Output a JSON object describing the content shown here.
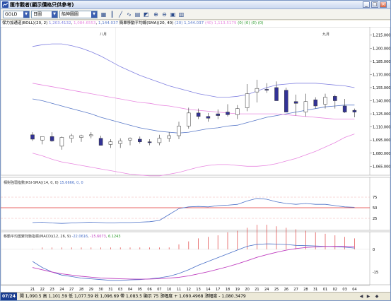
{
  "window": {
    "title": "匯市觀者(顯示價格只供參考)",
    "buttons": [
      "_",
      "□",
      "×"
    ]
  },
  "toolbar": {
    "symbol": "GOLD",
    "period": "日圖",
    "chart_style": "船神圖圖",
    "icon_names": [
      "bar-chart-icon",
      "candlestick-icon",
      "line-chart-icon",
      "indicator-icon",
      "area-chart-icon",
      "chart-type-icon",
      "zoom-in-icon",
      "zoom-out-icon",
      "window-icon",
      "print-icon"
    ]
  },
  "legend": {
    "label": "保力加通道(BOLL)(20, 2)",
    "upper": "1,203.4132",
    "lower": "1,084.6553",
    "mid": "1,144.037",
    "sma_label": "簡單移動平均線(SMA)(20, 40)",
    "sma20_text": "(20)",
    "sma20": "1,144.037",
    "sma40_text": "(40)",
    "sma40": "1,113.5179",
    "tail": "(0) (0) (0) (0)"
  },
  "months": [
    "八月",
    "九月"
  ],
  "price_axis": [
    "1,215.0000",
    "1,200.0000",
    "1,185.0000",
    "1,170.0000",
    "1,155.0000",
    "1,140.0000",
    "1,125.0000",
    "1,110.0000",
    "1,095.0000",
    "1,080.0000",
    "1,065.0000"
  ],
  "rsi": {
    "title_a": "相對強弱指數(RSI-SMA)(14, 0, 0)",
    "value": "15.6666, 0, 0",
    "axis": [
      "75",
      "50",
      "25"
    ]
  },
  "macd": {
    "title_a": "移動平均匯聚背馳指標(MACD)(12, 26, 9)",
    "v1": "-22.0616",
    "v2": "-15.6073",
    "v3": "6.1243",
    "axis": [
      "0",
      "-15"
    ]
  },
  "dates": [
    "21",
    "22",
    "23",
    "24",
    "27",
    "28",
    "29",
    "30",
    "31",
    "03",
    "04",
    "05",
    "06",
    "07",
    "10",
    "11",
    "12",
    "13",
    "14",
    "17",
    "18",
    "19",
    "20",
    "21",
    "24",
    "25",
    "26",
    "27",
    "28",
    "31",
    "01",
    "02",
    "03",
    "04"
  ],
  "status": {
    "date": "07/24",
    "text": "開 1,090.5  高 1,101.59  低 1,077.59  收 1,096.69  帶 1,083.5  顯示 75  漲幅度 + 1,090.4968  漲幅度 - 1,080.3479"
  },
  "colors": {
    "boll": "#8080e0",
    "sma20": "#5878c8",
    "sma40": "#e888e0",
    "candle": "#323296",
    "rsi": "#4a70c8",
    "rsi_ref": "#e03030",
    "macd_bar": "#e04040",
    "macd_line": "#4a70c8",
    "macd_signal": "#c040c0"
  },
  "chart_data": {
    "type": "candlestick",
    "x": [
      "21",
      "22",
      "23",
      "24",
      "27",
      "28",
      "29",
      "30",
      "31",
      "03",
      "04",
      "05",
      "06",
      "07",
      "10",
      "11",
      "12",
      "13",
      "14",
      "17",
      "18",
      "19",
      "20",
      "21",
      "24",
      "25",
      "26",
      "27",
      "28",
      "31",
      "01",
      "02",
      "03",
      "04"
    ],
    "open": [
      1101,
      1095,
      1099,
      1088,
      1097,
      1098,
      1100,
      1097,
      1090,
      1091,
      1095,
      1096,
      1093,
      1092,
      1097,
      1100,
      1111,
      1126,
      1122,
      1125,
      1127,
      1124,
      1132,
      1150,
      1153,
      1155,
      1152,
      1139,
      1127,
      1141,
      1136,
      1145,
      1134,
      1129
    ],
    "high": [
      1104,
      1099,
      1104,
      1099,
      1102,
      1101,
      1104,
      1100,
      1096,
      1097,
      1098,
      1099,
      1096,
      1101,
      1104,
      1116,
      1132,
      1131,
      1126,
      1130,
      1136,
      1135,
      1159,
      1164,
      1160,
      1162,
      1155,
      1147,
      1148,
      1144,
      1148,
      1147,
      1142,
      1131
    ],
    "low": [
      1094,
      1090,
      1093,
      1084,
      1092,
      1093,
      1097,
      1089,
      1086,
      1086,
      1089,
      1091,
      1089,
      1089,
      1093,
      1096,
      1108,
      1119,
      1116,
      1119,
      1122,
      1119,
      1128,
      1138,
      1149,
      1141,
      1128,
      1123,
      1122,
      1131,
      1131,
      1131,
      1126,
      1121
    ],
    "close": [
      1096,
      1099,
      1094,
      1098,
      1100,
      1100,
      1101,
      1089,
      1093,
      1094,
      1097,
      1093,
      1092,
      1097,
      1100,
      1111,
      1126,
      1122,
      1120,
      1123,
      1124,
      1131,
      1148,
      1154,
      1152,
      1140,
      1127,
      1137,
      1139,
      1134,
      1144,
      1140,
      1127,
      1127
    ],
    "boll_upper": [
      1202,
      1204,
      1205,
      1205,
      1203,
      1200,
      1196,
      1191,
      1185,
      1179,
      1174,
      1169,
      1165,
      1161,
      1157,
      1154,
      1151,
      1148,
      1146,
      1144,
      1144,
      1145,
      1147,
      1151,
      1155,
      1158,
      1159,
      1160,
      1160,
      1160,
      1159,
      1158,
      1157,
      1155
    ],
    "boll_mid": [
      1142,
      1140,
      1137,
      1134,
      1131,
      1128,
      1125,
      1121,
      1118,
      1115,
      1112,
      1109,
      1107,
      1105,
      1104,
      1103,
      1104,
      1106,
      1108,
      1109,
      1111,
      1112,
      1115,
      1118,
      1121,
      1123,
      1125,
      1127,
      1129,
      1131,
      1133,
      1134,
      1135,
      1135
    ],
    "boll_lower": [
      1080,
      1077,
      1073,
      1070,
      1068,
      1066,
      1064,
      1062,
      1060,
      1058,
      1056,
      1055,
      1054,
      1054,
      1056,
      1058,
      1061,
      1064,
      1066,
      1067,
      1067,
      1066,
      1065,
      1065,
      1066,
      1068,
      1071,
      1074,
      1078,
      1082,
      1087,
      1092,
      1098,
      1102
    ],
    "sma40": [
      1160,
      1158,
      1156,
      1154,
      1152,
      1150,
      1148,
      1146,
      1144,
      1142,
      1140,
      1138,
      1137,
      1135,
      1134,
      1132,
      1130,
      1129,
      1128,
      1127,
      1126,
      1125,
      1125,
      1125,
      1125,
      1125,
      1124,
      1123,
      1122,
      1121,
      1120,
      1119,
      1119,
      1119
    ],
    "ylim": [
      1058,
      1218
    ],
    "rsi": [
      15,
      16,
      14,
      13,
      14,
      15,
      16,
      15,
      14,
      15,
      15,
      16,
      17,
      20,
      34,
      48,
      52,
      53,
      52,
      55,
      56,
      58,
      66,
      72,
      70,
      64,
      60,
      58,
      60,
      58,
      58,
      55,
      52,
      51
    ],
    "rsi_ylim": [
      0,
      100
    ],
    "macd_hist": [
      0,
      1,
      1,
      1,
      1,
      1,
      1,
      1,
      1,
      1,
      1,
      1,
      1,
      1,
      1,
      3,
      5,
      7,
      8,
      9,
      11,
      12,
      14,
      16,
      16,
      15,
      14,
      13,
      12,
      11,
      10,
      9,
      8,
      7
    ],
    "macd_line": [
      -8,
      -12,
      -15,
      -17,
      -18,
      -19,
      -19.5,
      -20,
      -20.5,
      -20.5,
      -20.2,
      -20,
      -19.5,
      -18.8,
      -17.8,
      -16,
      -13.5,
      -10.5,
      -8,
      -5.5,
      -3,
      -0.5,
      2,
      3.3,
      3.6,
      3.5,
      3.2,
      2.6,
      2.4,
      2.2,
      2.0,
      1.8,
      1.4,
      0.8
    ],
    "macd_signal": [
      -12,
      -13.5,
      -15,
      -16.2,
      -17,
      -17.8,
      -18.4,
      -18.9,
      -19.2,
      -19.5,
      -19.6,
      -19.7,
      -19.6,
      -19.4,
      -19.0,
      -18.5,
      -17.5,
      -16.2,
      -14.8,
      -13.2,
      -11.5,
      -9.6,
      -7.5,
      -5.3,
      -3.5,
      -2.0,
      -0.6,
      0.5,
      1.2,
      1.6,
      1.9,
      2.0,
      1.9,
      1.7
    ],
    "macd_ylim": [
      -22,
      6
    ]
  }
}
